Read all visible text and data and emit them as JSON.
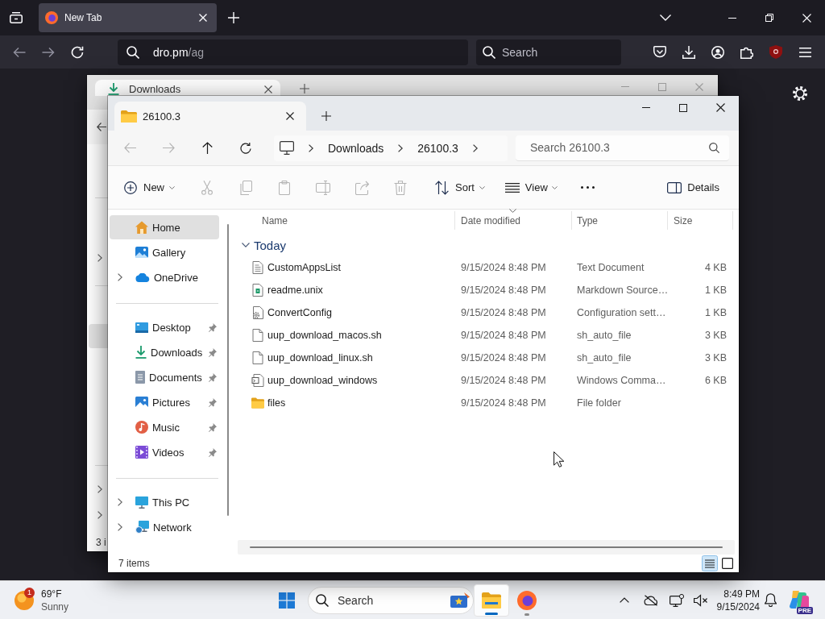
{
  "browser": {
    "tabs": [
      {
        "title": "New Tab",
        "selected": true
      }
    ],
    "nav_buttons": [
      {
        "kind": "back",
        "disabled": true
      },
      {
        "kind": "forward",
        "disabled": true
      },
      {
        "kind": "reload",
        "disabled": false
      }
    ],
    "address": {
      "host": "dro.pm",
      "path": "/ag"
    },
    "search": {
      "placeholder": "Search"
    }
  },
  "background_window": {
    "tabs": [
      {
        "title": "Downloads",
        "selected": true
      }
    ],
    "status": "3 i"
  },
  "explorer": {
    "tabs": [
      {
        "title": "26100.3",
        "selected": true
      }
    ],
    "nav_buttons": [
      {
        "kind": "back",
        "disabled": true
      },
      {
        "kind": "forward",
        "disabled": true
      },
      {
        "kind": "up",
        "disabled": false
      },
      {
        "kind": "refresh",
        "disabled": false
      }
    ],
    "breadcrumb": [
      "Downloads",
      "26100.3"
    ],
    "search": {
      "placeholder": "Search 26100.3"
    },
    "command_bar": {
      "new": {
        "label": "New"
      },
      "actions": [
        {
          "kind": "cut",
          "disabled": true
        },
        {
          "kind": "copy",
          "disabled": true
        },
        {
          "kind": "paste",
          "disabled": true
        },
        {
          "kind": "rename",
          "disabled": true
        },
        {
          "kind": "share",
          "disabled": true
        },
        {
          "kind": "delete",
          "disabled": true
        }
      ],
      "sort": {
        "label": "Sort"
      },
      "view": {
        "label": "View"
      },
      "details": {
        "label": "Details"
      }
    },
    "sidebar": {
      "groups": [
        {
          "items": [
            {
              "kind": "home",
              "label": "Home",
              "selected": true,
              "expandable": false,
              "pinned": false
            },
            {
              "kind": "gallery",
              "label": "Gallery",
              "selected": false,
              "expandable": false,
              "pinned": false
            },
            {
              "kind": "onedrive",
              "label": "OneDrive",
              "selected": false,
              "expandable": true,
              "pinned": false
            }
          ]
        },
        {
          "items": [
            {
              "kind": "desktop",
              "label": "Desktop",
              "selected": false,
              "expandable": false,
              "pinned": true
            },
            {
              "kind": "downloads",
              "label": "Downloads",
              "selected": false,
              "expandable": false,
              "pinned": true
            },
            {
              "kind": "documents",
              "label": "Documents",
              "selected": false,
              "expandable": false,
              "pinned": true
            },
            {
              "kind": "pictures",
              "label": "Pictures",
              "selected": false,
              "expandable": false,
              "pinned": true
            },
            {
              "kind": "music",
              "label": "Music",
              "selected": false,
              "expandable": false,
              "pinned": true
            },
            {
              "kind": "videos",
              "label": "Videos",
              "selected": false,
              "expandable": false,
              "pinned": true
            }
          ]
        },
        {
          "items": [
            {
              "kind": "pc",
              "label": "This PC",
              "selected": false,
              "expandable": true,
              "pinned": false
            },
            {
              "kind": "network",
              "label": "Network",
              "selected": false,
              "expandable": true,
              "pinned": false
            }
          ]
        }
      ]
    },
    "columns": [
      {
        "label": "Name",
        "sorted": false
      },
      {
        "label": "Date modified",
        "sorted": true
      },
      {
        "label": "Type",
        "sorted": false
      },
      {
        "label": "Size",
        "sorted": false
      }
    ],
    "groups": [
      {
        "label": "Today",
        "expanded": true,
        "rows": [
          {
            "kind": "text",
            "name": "CustomAppsList",
            "date": "9/15/2024 8:48 PM",
            "type": "Text Document",
            "size": "4 KB"
          },
          {
            "kind": "markdown",
            "name": "readme.unix",
            "date": "9/15/2024 8:48 PM",
            "type": "Markdown Source…",
            "size": "1 KB"
          },
          {
            "kind": "config",
            "name": "ConvertConfig",
            "date": "9/15/2024 8:48 PM",
            "type": "Configuration sett…",
            "size": "1 KB"
          },
          {
            "kind": "script",
            "name": "uup_download_macos.sh",
            "date": "9/15/2024 8:48 PM",
            "type": "sh_auto_file",
            "size": "3 KB"
          },
          {
            "kind": "script",
            "name": "uup_download_linux.sh",
            "date": "9/15/2024 8:48 PM",
            "type": "sh_auto_file",
            "size": "3 KB"
          },
          {
            "kind": "command",
            "name": "uup_download_windows",
            "date": "9/15/2024 8:48 PM",
            "type": "Windows Comma…",
            "size": "6 KB"
          },
          {
            "kind": "folder",
            "name": "files",
            "date": "9/15/2024 8:48 PM",
            "type": "File folder"
          }
        ]
      }
    ],
    "status": "7 items",
    "view_modes": [
      {
        "selected": true
      },
      {
        "selected": false
      }
    ]
  },
  "taskbar": {
    "weather": {
      "badge": "1",
      "temperature": "69°F",
      "condition": "Sunny"
    },
    "search": {
      "placeholder": "Search"
    },
    "apps": [
      {
        "kind": "explorer",
        "active": true
      },
      {
        "kind": "firefox",
        "active": false
      }
    ],
    "clock": {
      "time": "8:49 PM",
      "date": "9/15/2024"
    },
    "copilot": {
      "badge": "PRE"
    }
  }
}
